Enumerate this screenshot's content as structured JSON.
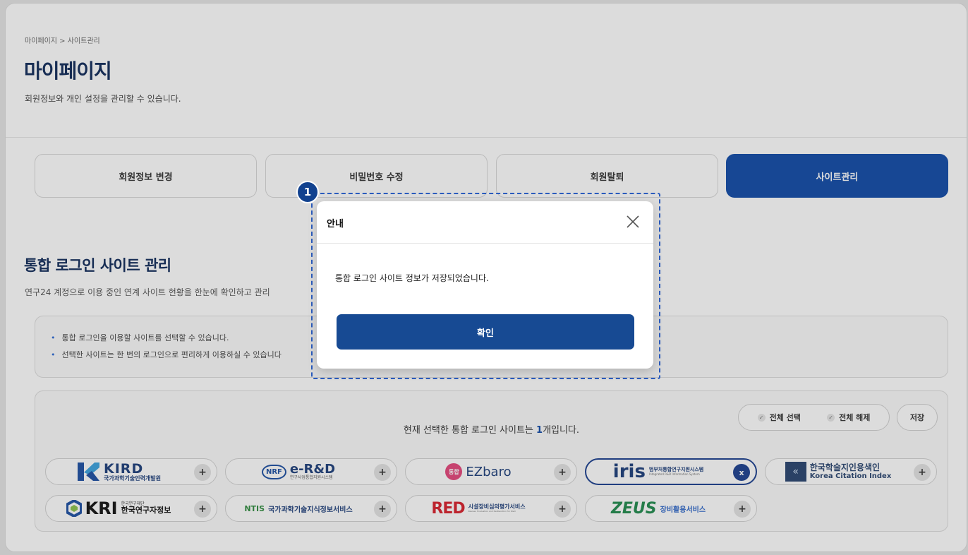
{
  "breadcrumb": "마이페이지 > 사이트관리",
  "page_title": "마이페이지",
  "page_desc": "회원정보와 개인 설정을 관리할 수 있습니다.",
  "tabs": [
    {
      "label": "회원정보 변경",
      "active": false
    },
    {
      "label": "비밀번호 수정",
      "active": false
    },
    {
      "label": "회원탈퇴",
      "active": false
    },
    {
      "label": "사이트관리",
      "active": true
    }
  ],
  "section": {
    "title": "통합 로그인 사이트 관리",
    "desc": "연구24 계정으로 이용 중인 연계 사이트 현황을 한눈에 확인하고 관리"
  },
  "info_items": [
    "통합 로그인을 이용할 사이트를 선택할 수 있습니다.",
    "선택한 사이트는 한 번의 로그인으로 편리하게 이용하실 수 있습니다"
  ],
  "selection": {
    "prefix": "현재 선택한 통합 로그인 사이트는 ",
    "count": "1",
    "suffix": "개입니다.",
    "select_all": "전체 선택",
    "deselect_all": "전체 해제",
    "save": "저장"
  },
  "sites": [
    {
      "logo_main": "KIRD",
      "logo_sub": "국가과학기술인력개발원",
      "action": "+",
      "selected": false
    },
    {
      "logo_main": "e-R&D",
      "logo_sub": "연구사업통합지원시스템",
      "logo_badge": "NRF",
      "action": "+",
      "selected": false
    },
    {
      "logo_main": "EZbaro",
      "logo_badge": "통합",
      "action": "+",
      "selected": false
    },
    {
      "logo_main": "iris",
      "logo_sub": "범부처통합연구지원시스템",
      "logo_sub2": "Integrated R&D Information System",
      "action": "x",
      "selected": true
    },
    {
      "logo_main": "한국학술지인용색인",
      "logo_sub": "Korea Citation Index",
      "action": "+",
      "selected": false
    },
    {
      "logo_main": "KRI",
      "logo_sub": "한국연구자정보",
      "logo_sub2": "한국연구재단",
      "action": "+",
      "selected": false
    },
    {
      "logo_main": "국가과학기술지식정보서비스",
      "logo_badge": "NTIS",
      "action": "+",
      "selected": false
    },
    {
      "logo_main": "RED",
      "logo_sub": "시설장비심의평가서비스",
      "logo_sub2": "Review, Evaluation and Deliberation for R&D",
      "action": "+",
      "selected": false
    },
    {
      "logo_main": "ZEUS",
      "logo_sub": "장비활용서비스",
      "action": "+",
      "selected": false
    }
  ],
  "modal": {
    "step": "1",
    "title": "안내",
    "message": "통합 로그인 사이트 정보가 저장되었습니다.",
    "confirm": "확인"
  },
  "colors": {
    "primary": "#0f4aa8",
    "title": "#0f2a5a",
    "selected_border": "#1a3f8f"
  }
}
